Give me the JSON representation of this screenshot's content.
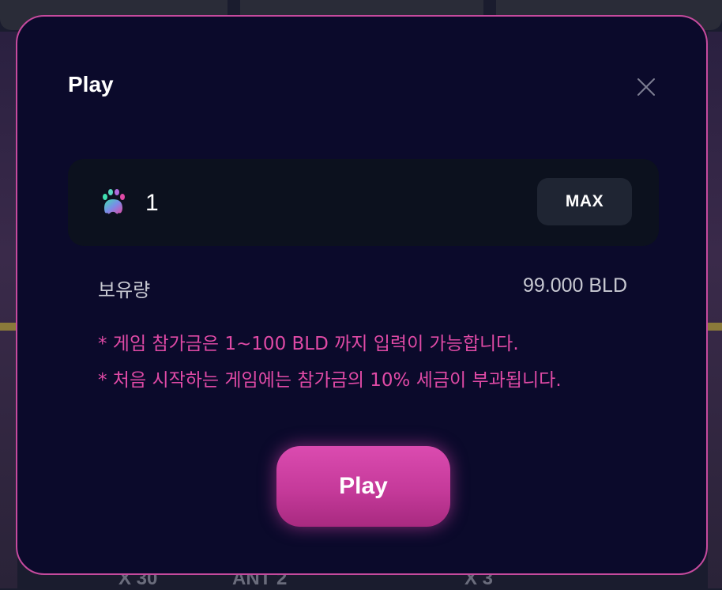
{
  "modal": {
    "title": "Play",
    "close_icon": "close-icon",
    "amount": {
      "token_icon": "paw-token-icon",
      "value": "1",
      "max_label": "MAX"
    },
    "balance": {
      "label": "보유량",
      "value": "99.000 BLD"
    },
    "notices": [
      "* 게임 참가금은 1~100 BLD 까지 입력이 가능합니다.",
      "* 처음 시작하는 게임에는 참가금의 10% 세금이 부과됩니다."
    ],
    "play_label": "Play"
  },
  "background": {
    "labels": [
      "X 30",
      "ANT 2",
      "X 3"
    ]
  },
  "colors": {
    "modal_bg": "#0b0a2b",
    "modal_border": "#c64a9e",
    "accent_pink": "#e04aa6",
    "input_bg": "#0c111e",
    "max_bg": "#1f2533"
  }
}
